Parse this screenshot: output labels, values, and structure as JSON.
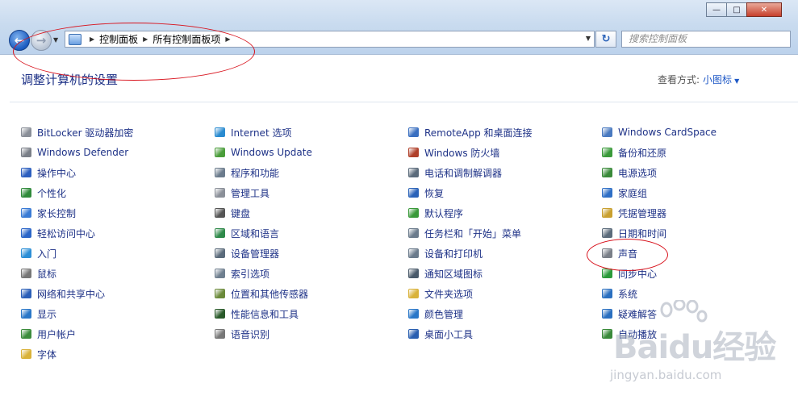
{
  "address_bar": {
    "crumbs": [
      "控制面板",
      "所有控制面板项"
    ],
    "search_placeholder": "搜索控制面板"
  },
  "header": {
    "title": "调整计算机的设置",
    "view_by_label": "查看方式:",
    "view_by_value": "小图标"
  },
  "columns": [
    [
      {
        "label": "BitLocker 驱动器加密",
        "icon": "bitlocker-icon",
        "color": "#8a8f98"
      },
      {
        "label": "Windows Defender",
        "icon": "defender-icon",
        "color": "#7a7f88"
      },
      {
        "label": "操作中心",
        "icon": "action-center-flag-icon",
        "color": "#2c5fbf"
      },
      {
        "label": "个性化",
        "icon": "personalization-icon",
        "color": "#2f8a3a"
      },
      {
        "label": "家长控制",
        "icon": "parental-controls-icon",
        "color": "#3a7bd5"
      },
      {
        "label": "轻松访问中心",
        "icon": "ease-of-access-icon",
        "color": "#2b66c8"
      },
      {
        "label": "入门",
        "icon": "getting-started-icon",
        "color": "#2d8fd6"
      },
      {
        "label": "鼠标",
        "icon": "mouse-icon",
        "color": "#777777"
      },
      {
        "label": "网络和共享中心",
        "icon": "network-icon",
        "color": "#2b5fb8"
      },
      {
        "label": "显示",
        "icon": "display-icon",
        "color": "#2a77c8"
      },
      {
        "label": "用户帐户",
        "icon": "user-accounts-icon",
        "color": "#3c8c3c"
      },
      {
        "label": "字体",
        "icon": "fonts-folder-icon",
        "color": "#d9b23a"
      }
    ],
    [
      {
        "label": "Internet 选项",
        "icon": "internet-options-icon",
        "color": "#2a8bd0"
      },
      {
        "label": "Windows Update",
        "icon": "windows-update-icon",
        "color": "#4a9d3a"
      },
      {
        "label": "程序和功能",
        "icon": "programs-features-icon",
        "color": "#6b7b8c"
      },
      {
        "label": "管理工具",
        "icon": "admin-tools-icon",
        "color": "#8a8f98"
      },
      {
        "label": "键盘",
        "icon": "keyboard-icon",
        "color": "#555555"
      },
      {
        "label": "区域和语言",
        "icon": "region-language-icon",
        "color": "#2f8a4a"
      },
      {
        "label": "设备管理器",
        "icon": "device-manager-icon",
        "color": "#5b6b7b"
      },
      {
        "label": "索引选项",
        "icon": "indexing-icon",
        "color": "#6f7f8f"
      },
      {
        "label": "位置和其他传感器",
        "icon": "sensors-icon",
        "color": "#6b8a3a"
      },
      {
        "label": "性能信息和工具",
        "icon": "performance-icon",
        "color": "#2a5a2a"
      },
      {
        "label": "语音识别",
        "icon": "microphone-icon",
        "color": "#777777"
      }
    ],
    [
      {
        "label": "RemoteApp 和桌面连接",
        "icon": "remoteapp-icon",
        "color": "#3a6fc0"
      },
      {
        "label": "Windows 防火墙",
        "icon": "firewall-icon",
        "color": "#b0402a"
      },
      {
        "label": "电话和调制解调器",
        "icon": "phone-modem-icon",
        "color": "#5b6b7b"
      },
      {
        "label": "恢复",
        "icon": "recovery-icon",
        "color": "#2a62b8"
      },
      {
        "label": "默认程序",
        "icon": "default-programs-icon",
        "color": "#3a9a3a"
      },
      {
        "label": "任务栏和「开始」菜单",
        "icon": "taskbar-icon",
        "color": "#6b7b8c"
      },
      {
        "label": "设备和打印机",
        "icon": "printer-icon",
        "color": "#6b7b8c"
      },
      {
        "label": "通知区域图标",
        "icon": "notification-icon",
        "color": "#4a5a6a"
      },
      {
        "label": "文件夹选项",
        "icon": "folder-options-icon",
        "color": "#d9b23a"
      },
      {
        "label": "颜色管理",
        "icon": "color-management-icon",
        "color": "#2a77c8"
      },
      {
        "label": "桌面小工具",
        "icon": "gadgets-icon",
        "color": "#2a5fb0"
      }
    ],
    [
      {
        "label": "Windows CardSpace",
        "icon": "cardspace-icon",
        "color": "#4a7ac0"
      },
      {
        "label": "备份和还原",
        "icon": "backup-restore-icon",
        "color": "#3a9a3a"
      },
      {
        "label": "电源选项",
        "icon": "power-options-icon",
        "color": "#3a8a3a"
      },
      {
        "label": "家庭组",
        "icon": "homegroup-icon",
        "color": "#2f6fc6"
      },
      {
        "label": "凭据管理器",
        "icon": "credential-manager-icon",
        "color": "#c9a030"
      },
      {
        "label": "日期和时间",
        "icon": "date-time-icon",
        "color": "#5b6b7b"
      },
      {
        "label": "声音",
        "icon": "speaker-icon",
        "color": "#7a7f88"
      },
      {
        "label": "同步中心",
        "icon": "sync-center-icon",
        "color": "#2a9a3a"
      },
      {
        "label": "系统",
        "icon": "system-icon",
        "color": "#2a6fc0"
      },
      {
        "label": "疑难解答",
        "icon": "troubleshooting-icon",
        "color": "#2a6fc0"
      },
      {
        "label": "自动播放",
        "icon": "autoplay-icon",
        "color": "#3a8a3a"
      }
    ]
  ],
  "watermark": {
    "main": "Baidu经验",
    "sub": "jingyan.baidu.com"
  },
  "colors": {
    "link": "#1e3287",
    "accent": "#1e58c6",
    "annotation": "#d8121c"
  }
}
